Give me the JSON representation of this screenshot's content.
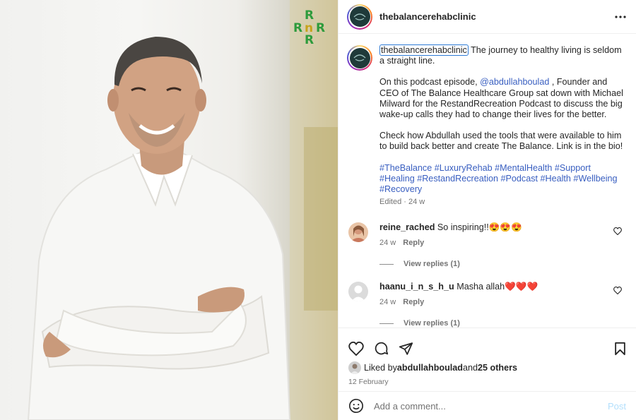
{
  "post": {
    "username": "thebalancerehabclinic",
    "more_icon": "more-horizontal-icon"
  },
  "caption": {
    "username": "thebalancerehabclinic",
    "line1": " The journey to healthy living is seldom a straight line.",
    "p2_before": "On this podcast episode, ",
    "p2_mention": "@abdullahboulad",
    "p2_after": " , Founder and CEO of The Balance Healthcare Group sat down with Michael Milward for the RestandRecreation Podcast to discuss the big wake-up calls they had to change their lives for the better.",
    "p3": "Check how Abdullah used the tools that were available to him to build back better and create The Balance. Link is in the bio!",
    "hashtags": "#TheBalance #LuxuryRehab #MentalHealth #Support #Healing #RestandRecreation #Podcast #Health #Wellbeing #Recovery",
    "edited": "Edited",
    "time": "24 w"
  },
  "comments": [
    {
      "username": "reine_rached",
      "text": "So inspiring!!😍😍😍",
      "time": "24 w",
      "reply_label": "Reply",
      "view_replies": "View replies (1)"
    },
    {
      "username": "haanu_i_n_s_h_u",
      "text": "Masha allah❤️❤️❤️",
      "time": "24 w",
      "reply_label": "Reply",
      "view_replies": "View replies (1)"
    }
  ],
  "likes": {
    "prefix": "Liked by ",
    "user": "abdullahboulad",
    "middle": " and ",
    "others": "25 others"
  },
  "date": "12 February",
  "add_comment": {
    "placeholder": "Add a comment...",
    "post_label": "Post"
  },
  "colors": {
    "link": "#385ec0",
    "post_disabled": "#b2dffc",
    "logo_green": "#2e9b3c",
    "logo_gold": "#c7a21b"
  },
  "icons": [
    "heart-icon",
    "comment-icon",
    "share-icon",
    "bookmark-icon",
    "emoji-icon"
  ]
}
